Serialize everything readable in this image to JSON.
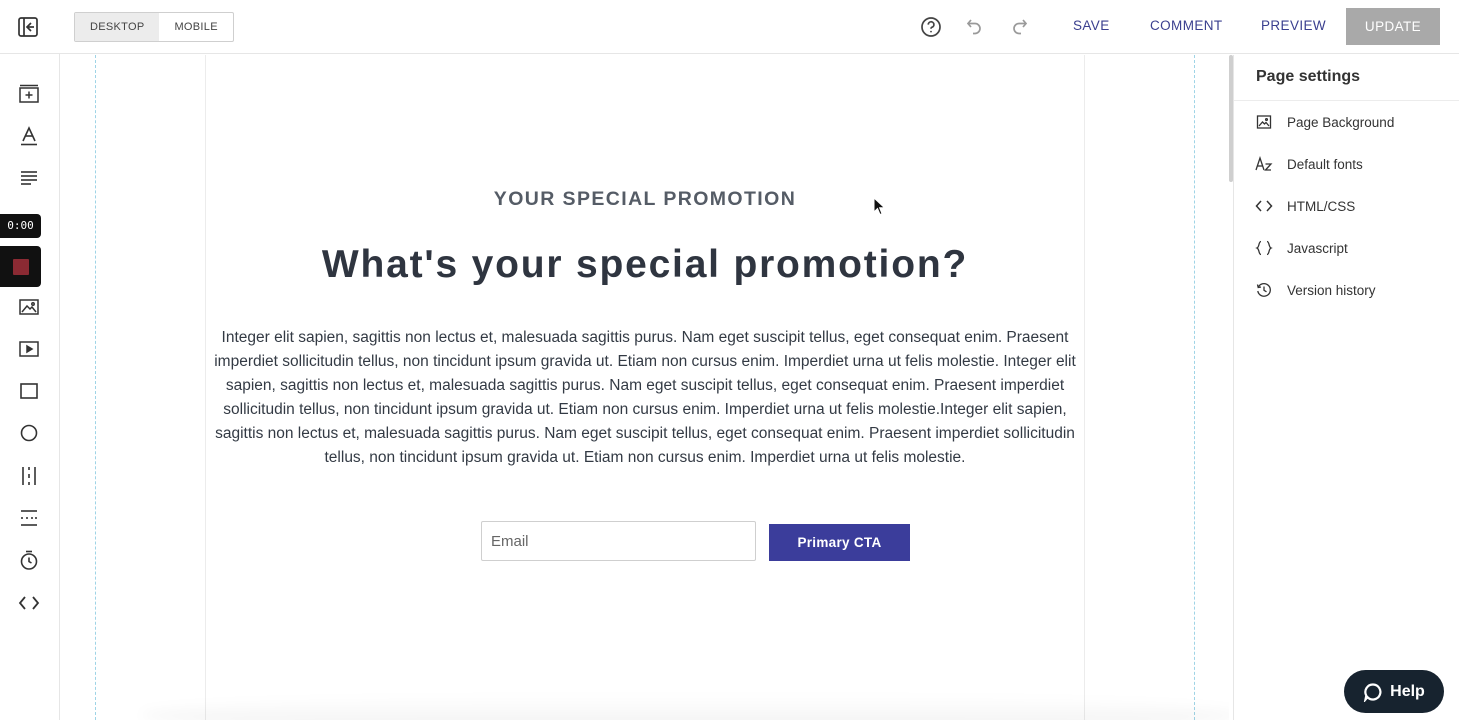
{
  "topbar": {
    "exit_icon": "exit-editor-icon",
    "device_modes": [
      "DESKTOP",
      "MOBILE"
    ],
    "active_device": "DESKTOP",
    "help_icon": "question-circle-icon",
    "undo_icon": "undo-icon",
    "redo_icon": "redo-icon",
    "save_label": "SAVE",
    "comment_label": "COMMENT",
    "preview_label": "PREVIEW",
    "update_label": "UPDATE"
  },
  "left_rail": {
    "timer": "0:00",
    "items": [
      "add-section-icon",
      "text-icon",
      "paragraph-icon",
      "record-stop-icon",
      "image-icon",
      "video-icon",
      "box-icon",
      "circle-icon",
      "columns-icon",
      "divider-icon",
      "countdown-timer-icon",
      "code-icon"
    ]
  },
  "page": {
    "eyebrow": "YOUR SPECIAL PROMOTION",
    "title": "What's your special promotion?",
    "body": "Integer elit sapien, sagittis non lectus et, malesuada sagittis purus. Nam eget suscipit tellus, eget consequat enim. Praesent imperdiet sollicitudin tellus, non tincidunt ipsum gravida ut. Etiam non cursus enim. Imperdiet urna ut felis molestie. Integer elit sapien, sagittis non lectus et, malesuada sagittis purus. Nam eget suscipit tellus, eget consequat enim. Praesent imperdiet sollicitudin tellus, non tincidunt ipsum gravida ut. Etiam non cursus enim. Imperdiet urna ut felis molestie.Integer elit sapien, sagittis non lectus et, malesuada sagittis purus. Nam eget suscipit tellus, eget consequat enim. Praesent imperdiet sollicitudin tellus, non tincidunt ipsum gravida ut. Etiam non cursus enim. Imperdiet urna ut felis molestie.",
    "email_placeholder": "Email",
    "cta_label": "Primary CTA"
  },
  "right_panel": {
    "title": "Page settings",
    "items": [
      {
        "label": "Page Background",
        "icon": "image-icon"
      },
      {
        "label": "Default fonts",
        "icon": "font-az-icon"
      },
      {
        "label": "HTML/CSS",
        "icon": "code-icon"
      },
      {
        "label": "Javascript",
        "icon": "braces-icon"
      },
      {
        "label": "Version history",
        "icon": "history-icon"
      }
    ]
  },
  "help_widget": {
    "label": "Help",
    "icon": "chat-bubble-icon"
  },
  "colors": {
    "accent": "#3b3d9b",
    "link": "#3a3f8f",
    "update_disabled": "#a9a9a9",
    "help_bg": "#17232f",
    "record": "#8b2a33"
  }
}
